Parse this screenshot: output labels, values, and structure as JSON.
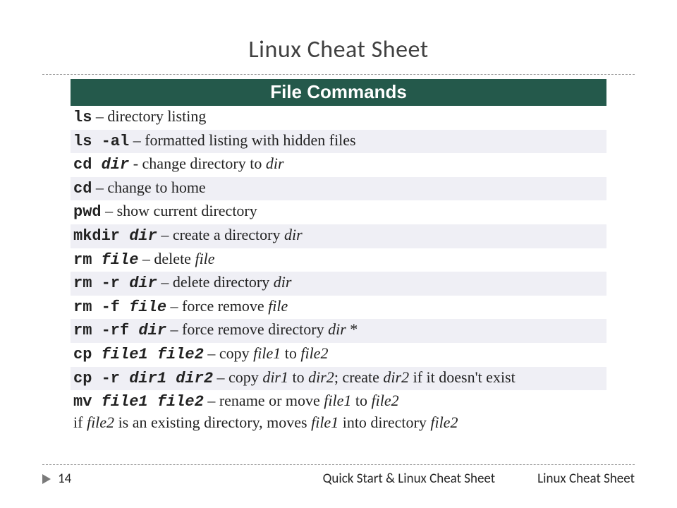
{
  "title": "Linux Cheat Sheet",
  "section_header": "File Commands",
  "rows": [
    {
      "cmd": "ls",
      "arg": "",
      "sep": " – ",
      "desc_pre": "directory listing",
      "desc_i": "",
      "desc_post": ""
    },
    {
      "cmd": "ls -al",
      "arg": "",
      "sep": " – ",
      "desc_pre": "formatted listing with hidden files",
      "desc_i": "",
      "desc_post": ""
    },
    {
      "cmd": "cd ",
      "arg": "dir",
      "sep": " - ",
      "desc_pre": "change directory to ",
      "desc_i": "dir",
      "desc_post": ""
    },
    {
      "cmd": "cd",
      "arg": "",
      "sep": " – ",
      "desc_pre": "change to home",
      "desc_i": "",
      "desc_post": ""
    },
    {
      "cmd": "pwd",
      "arg": "",
      "sep": " – ",
      "desc_pre": "show current directory",
      "desc_i": "",
      "desc_post": ""
    },
    {
      "cmd": "mkdir ",
      "arg": "dir",
      "sep": " – ",
      "desc_pre": "create a directory ",
      "desc_i": "dir",
      "desc_post": ""
    },
    {
      "cmd": "rm ",
      "arg": "file",
      "sep": " – ",
      "desc_pre": "delete ",
      "desc_i": "file",
      "desc_post": ""
    },
    {
      "cmd": "rm -r ",
      "arg": "dir",
      "sep": " – ",
      "desc_pre": "delete directory ",
      "desc_i": "dir",
      "desc_post": ""
    },
    {
      "cmd": "rm -f ",
      "arg": "file",
      "sep": " – ",
      "desc_pre": "force remove ",
      "desc_i": "file",
      "desc_post": ""
    },
    {
      "cmd": "rm -rf ",
      "arg": "dir",
      "sep": " – ",
      "desc_pre": "force remove directory ",
      "desc_i": "dir",
      "desc_post": " *"
    },
    {
      "cmd": "cp ",
      "arg": "file1 file2",
      "sep": " – ",
      "desc_pre": "copy ",
      "desc_i": "file1",
      "desc_post_mid": " to ",
      "desc_i2": "file2",
      "desc_post": ""
    }
  ],
  "row_cp_r": {
    "cmd": "cp -r ",
    "arg": "dir1 dir2",
    "sep": " – ",
    "t1": "copy ",
    "i1": "dir1",
    "t2": " to ",
    "i2": "dir2",
    "t3": "; create ",
    "i3": "dir2",
    "t4": " if it doesn't exist"
  },
  "row_mv": {
    "cmd": "mv ",
    "arg": "file1 file2",
    "sep": " – ",
    "t1": "rename or move ",
    "i1": "file1",
    "t2": " to ",
    "i2": "file2",
    "l2a": "if ",
    "l2i1": "file2",
    "l2b": " is an existing directory, moves ",
    "l2i2": "file1",
    "l2c": " into directory ",
    "l2i3": "file2"
  },
  "footer": {
    "page": "14",
    "mid": "Quick Start & Linux Cheat Sheet",
    "right": "Linux Cheat Sheet"
  }
}
